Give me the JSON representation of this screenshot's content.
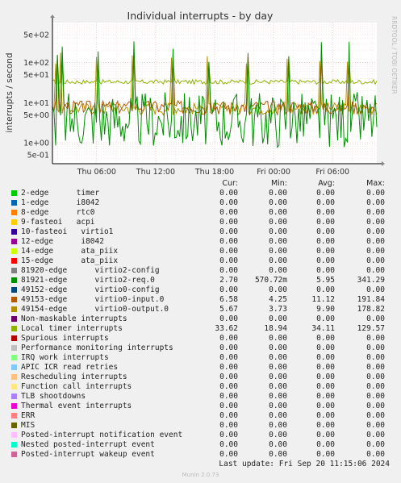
{
  "chart_data": {
    "type": "line",
    "title": "Individual interrupts - by day",
    "ylabel": "interrupts / second",
    "yscale": "log",
    "ylim": [
      0.3,
      1000
    ],
    "ytick_labels": [
      "5e-01",
      "1e+00",
      "5e+00",
      "1e+01",
      "5e+01",
      "1e+02",
      "5e+02"
    ],
    "ytick_values": [
      0.5,
      1,
      5,
      10,
      50,
      100,
      500
    ],
    "xtick_labels": [
      "Thu 06:00",
      "Thu 12:00",
      "Thu 18:00",
      "Fri 00:00",
      "Fri 06:00"
    ],
    "xtick_hours": [
      6,
      12,
      18,
      24,
      30
    ],
    "x_range_hours": [
      1.5,
      34.5
    ],
    "grid": true,
    "side_label": "RRDTOOL / TOBI OETIKER",
    "series_plotted": [
      {
        "name": "81921-edge",
        "color": "#008f00",
        "min": 0.57,
        "avg": 5.95,
        "max": 341.29,
        "cur": 2.7
      },
      {
        "name": "49153-edge",
        "color": "#b35a00",
        "min": 4.25,
        "avg": 11.12,
        "max": 191.84,
        "cur": 6.58
      },
      {
        "name": "49154-edge",
        "color": "#b38f00",
        "min": 3.73,
        "avg": 9.9,
        "max": 178.82,
        "cur": 5.67
      },
      {
        "name": "Local timer interrupts",
        "color": "#8fb300",
        "min": 18.94,
        "avg": 34.11,
        "max": 129.57,
        "cur": 33.62
      }
    ]
  },
  "legend": {
    "headers": {
      "cur": "Cur:",
      "min": "Min:",
      "avg": "Avg:",
      "max": "Max:"
    },
    "rows": [
      {
        "label": "2-edge      timer",
        "color": "#00cc00",
        "cur": "0.00",
        "min": "0.00",
        "avg": "0.00",
        "max": "0.00"
      },
      {
        "label": "1-edge      i8042",
        "color": "#0066b3",
        "cur": "0.00",
        "min": "0.00",
        "avg": "0.00",
        "max": "0.00"
      },
      {
        "label": "8-edge      rtc0",
        "color": "#ff8000",
        "cur": "0.00",
        "min": "0.00",
        "avg": "0.00",
        "max": "0.00"
      },
      {
        "label": "9-fasteoi   acpi",
        "color": "#ffcc00",
        "cur": "0.00",
        "min": "0.00",
        "avg": "0.00",
        "max": "0.00"
      },
      {
        "label": "10-fasteoi   virtio1",
        "color": "#330099",
        "cur": "0.00",
        "min": "0.00",
        "avg": "0.00",
        "max": "0.00"
      },
      {
        "label": "12-edge      i8042",
        "color": "#990099",
        "cur": "0.00",
        "min": "0.00",
        "avg": "0.00",
        "max": "0.00"
      },
      {
        "label": "14-edge      ata_piix",
        "color": "#ccff00",
        "cur": "0.00",
        "min": "0.00",
        "avg": "0.00",
        "max": "0.00"
      },
      {
        "label": "15-edge      ata_piix",
        "color": "#ff0000",
        "cur": "0.00",
        "min": "0.00",
        "avg": "0.00",
        "max": "0.00"
      },
      {
        "label": "81920-edge      virtio2-config",
        "color": "#808080",
        "cur": "0.00",
        "min": "0.00",
        "avg": "0.00",
        "max": "0.00"
      },
      {
        "label": "81921-edge      virtio2-req.0",
        "color": "#008f00",
        "cur": "2.70",
        "min": "570.72m",
        "avg": "5.95",
        "max": "341.29"
      },
      {
        "label": "49152-edge      virtio0-config",
        "color": "#00487d",
        "cur": "0.00",
        "min": "0.00",
        "avg": "0.00",
        "max": "0.00"
      },
      {
        "label": "49153-edge      virtio0-input.0",
        "color": "#b35a00",
        "cur": "6.58",
        "min": "4.25",
        "avg": "11.12",
        "max": "191.84"
      },
      {
        "label": "49154-edge      virtio0-output.0",
        "color": "#b38f00",
        "cur": "5.67",
        "min": "3.73",
        "avg": "9.90",
        "max": "178.82"
      },
      {
        "label": "Non-maskable interrupts",
        "color": "#6b006b",
        "cur": "0.00",
        "min": "0.00",
        "avg": "0.00",
        "max": "0.00"
      },
      {
        "label": "Local timer interrupts",
        "color": "#8fb300",
        "cur": "33.62",
        "min": "18.94",
        "avg": "34.11",
        "max": "129.57"
      },
      {
        "label": "Spurious interrupts",
        "color": "#b30000",
        "cur": "0.00",
        "min": "0.00",
        "avg": "0.00",
        "max": "0.00"
      },
      {
        "label": "Performance monitoring interrupts",
        "color": "#bebebe",
        "cur": "0.00",
        "min": "0.00",
        "avg": "0.00",
        "max": "0.00"
      },
      {
        "label": "IRQ work interrupts",
        "color": "#80ff80",
        "cur": "0.00",
        "min": "0.00",
        "avg": "0.00",
        "max": "0.00"
      },
      {
        "label": "APIC ICR read retries",
        "color": "#80c9ff",
        "cur": "0.00",
        "min": "0.00",
        "avg": "0.00",
        "max": "0.00"
      },
      {
        "label": "Rescheduling interrupts",
        "color": "#ffc080",
        "cur": "0.00",
        "min": "0.00",
        "avg": "0.00",
        "max": "0.00"
      },
      {
        "label": "Function call interrupts",
        "color": "#ffe680",
        "cur": "0.00",
        "min": "0.00",
        "avg": "0.00",
        "max": "0.00"
      },
      {
        "label": "TLB shootdowns",
        "color": "#aa80ff",
        "cur": "0.00",
        "min": "0.00",
        "avg": "0.00",
        "max": "0.00"
      },
      {
        "label": "Thermal event interrupts",
        "color": "#ee00cc",
        "cur": "0.00",
        "min": "0.00",
        "avg": "0.00",
        "max": "0.00"
      },
      {
        "label": "ERR",
        "color": "#ff8080",
        "cur": "0.00",
        "min": "0.00",
        "avg": "0.00",
        "max": "0.00"
      },
      {
        "label": "MIS",
        "color": "#666600",
        "cur": "0.00",
        "min": "0.00",
        "avg": "0.00",
        "max": "0.00"
      },
      {
        "label": "Posted-interrupt notification event",
        "color": "#ffbfff",
        "cur": "0.00",
        "min": "0.00",
        "avg": "0.00",
        "max": "0.00"
      },
      {
        "label": "Nested posted-interrupt event",
        "color": "#00ffcc",
        "cur": "0.00",
        "min": "0.00",
        "avg": "0.00",
        "max": "0.00"
      },
      {
        "label": "Posted-interrupt wakeup event",
        "color": "#cc6699",
        "cur": "0.00",
        "min": "0.00",
        "avg": "0.00",
        "max": "0.00"
      }
    ]
  },
  "last_update": "Last update: Fri Sep 20 11:15:06 2024",
  "version": "Munin 2.0.73"
}
